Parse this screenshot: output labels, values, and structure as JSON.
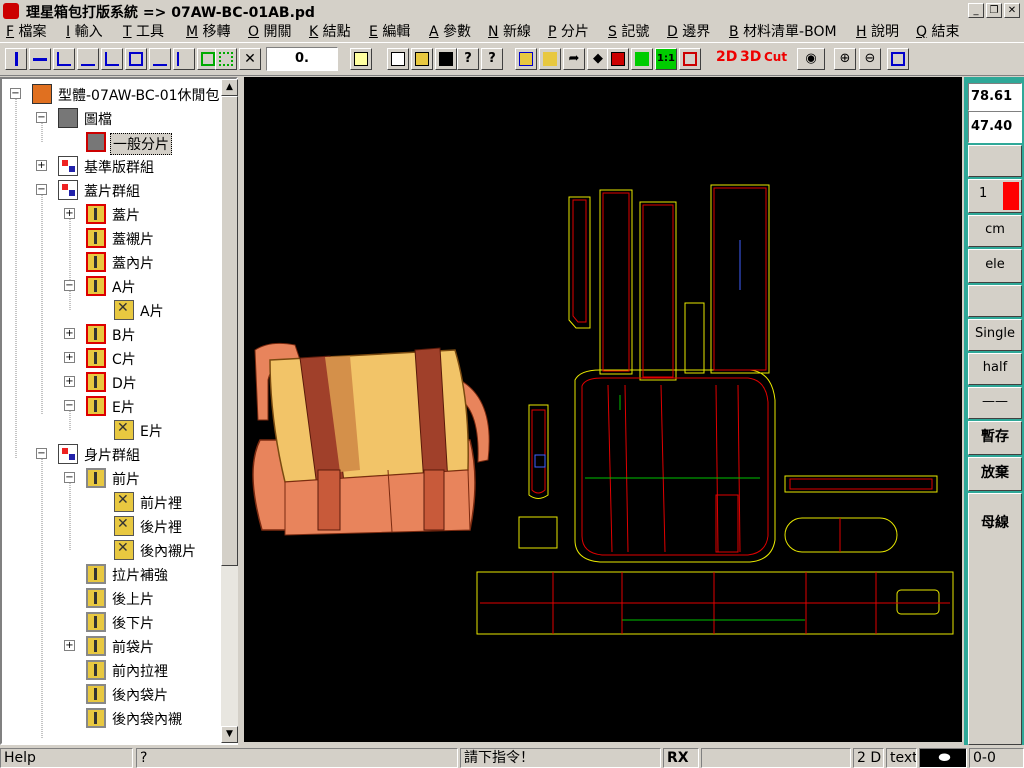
{
  "window": {
    "title": "理星箱包打版系統 => 07AW-BC-01AB.pd",
    "controls": [
      "_",
      "❐",
      "✕"
    ]
  },
  "menu": [
    {
      "key": "F",
      "label": "檔案"
    },
    {
      "key": "I",
      "label": "輸入"
    },
    {
      "key": "T",
      "label": "工具"
    },
    {
      "key": "M",
      "label": "移轉"
    },
    {
      "key": "O",
      "label": "開關"
    },
    {
      "key": "K",
      "label": "結點"
    },
    {
      "key": "E",
      "label": "編輯"
    },
    {
      "key": "A",
      "label": "參數"
    },
    {
      "key": "N",
      "label": "新線"
    },
    {
      "key": "P",
      "label": "分片"
    },
    {
      "key": "S",
      "label": "記號"
    },
    {
      "key": "D",
      "label": "邊界"
    },
    {
      "key": "B",
      "label": "材料清單-BOM"
    },
    {
      "key": "H",
      "label": "說明"
    },
    {
      "key": "Q",
      "label": "結束"
    }
  ],
  "toolbar": {
    "value_box": "0.",
    "mode_2d": "2D",
    "mode_3d": "3D",
    "mode_cut": "Cut"
  },
  "tree": {
    "nodes": [
      {
        "label": "型體-07AW-BC-01休閒包",
        "expander": "−",
        "icon": "root"
      },
      {
        "label": "圖檔",
        "expander": "−",
        "icon": "folder"
      },
      {
        "label": "一般分片",
        "expander": "",
        "icon": "folder"
      },
      {
        "label": "基準版群組",
        "expander": "+",
        "icon": "group"
      },
      {
        "label": "蓋片群組",
        "expander": "−",
        "icon": "group"
      },
      {
        "label": "蓋片",
        "expander": "+",
        "icon": "piece"
      },
      {
        "label": "蓋襯片",
        "expander": "",
        "icon": "piece"
      },
      {
        "label": "蓋內片",
        "expander": "",
        "icon": "piece"
      },
      {
        "label": "A片",
        "expander": "−",
        "icon": "piece"
      },
      {
        "label": "A片",
        "expander": "",
        "icon": "sub"
      },
      {
        "label": "B片",
        "expander": "+",
        "icon": "piece"
      },
      {
        "label": "C片",
        "expander": "+",
        "icon": "piece"
      },
      {
        "label": "D片",
        "expander": "+",
        "icon": "piece"
      },
      {
        "label": "E片",
        "expander": "−",
        "icon": "piece"
      },
      {
        "label": "E片",
        "expander": "",
        "icon": "sub"
      },
      {
        "label": "身片群組",
        "expander": "−",
        "icon": "group"
      },
      {
        "label": "前片",
        "expander": "−",
        "icon": "piece"
      },
      {
        "label": "前片裡",
        "expander": "",
        "icon": "sub"
      },
      {
        "label": "後片裡",
        "expander": "",
        "icon": "sub"
      },
      {
        "label": "後內襯片",
        "expander": "",
        "icon": "sub"
      },
      {
        "label": "拉片補強",
        "expander": "",
        "icon": "piece"
      },
      {
        "label": "後上片",
        "expander": "",
        "icon": "piece"
      },
      {
        "label": "後下片",
        "expander": "",
        "icon": "piece"
      },
      {
        "label": "前袋片",
        "expander": "+",
        "icon": "piece"
      },
      {
        "label": "前內拉裡",
        "expander": "",
        "icon": "piece"
      },
      {
        "label": "後內袋片",
        "expander": "",
        "icon": "piece"
      },
      {
        "label": "後內袋內襯",
        "expander": "",
        "icon": "piece"
      }
    ]
  },
  "right_panel": {
    "x_value": "78.61",
    "y_value": "47.40",
    "layer": "1",
    "layer_color": "#ff0000",
    "unit": "cm",
    "mode": "ele",
    "single": "Single",
    "half": "half",
    "line": "——",
    "save_temp": "暫存",
    "discard": "放棄",
    "mother_line": "母線"
  },
  "status": {
    "help": "Help",
    "question": "?",
    "prompt": "請下指令！",
    "rx": "RX",
    "dim": "2 D",
    "text": "text",
    "coords": "0-0"
  },
  "colors": {
    "canvas_bg": "#000000",
    "pattern_yellow": "#e8e800",
    "pattern_red": "#e00000",
    "pattern_green": "#00c000",
    "panel_teal": "#2fa898"
  }
}
